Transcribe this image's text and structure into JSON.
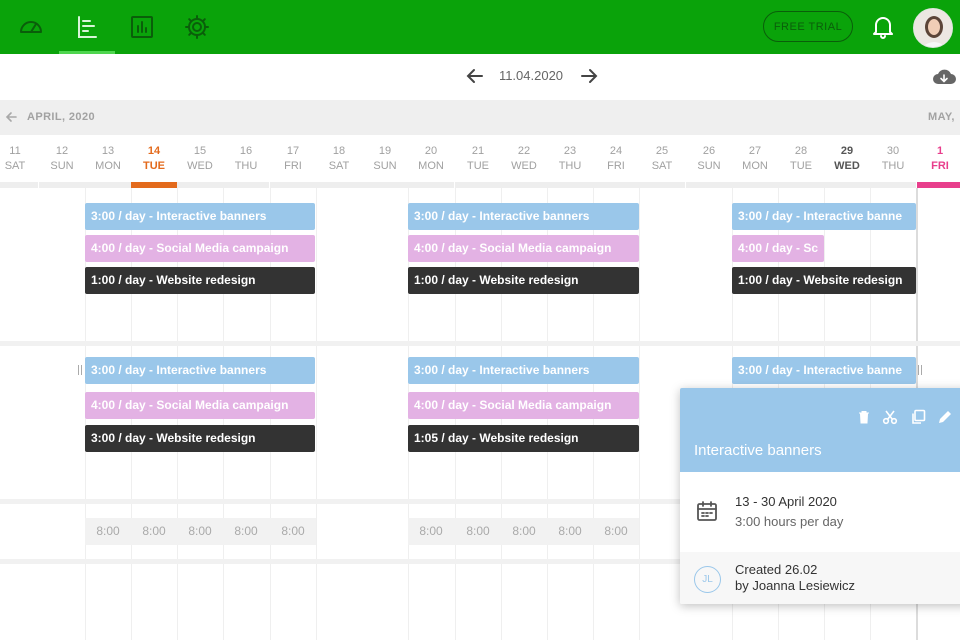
{
  "topbar": {
    "trial_label": "FREE TRIAL",
    "icons": [
      "dashboard-icon",
      "timeline-icon",
      "reports-icon",
      "settings-icon"
    ]
  },
  "date_nav": {
    "current": "11.04.2020"
  },
  "months": {
    "current": "APRIL, 2020",
    "next": "MAY,"
  },
  "days": [
    {
      "num": "11",
      "wd": "SAT"
    },
    {
      "num": "12",
      "wd": "SUN"
    },
    {
      "num": "13",
      "wd": "MON"
    },
    {
      "num": "14",
      "wd": "TUE"
    },
    {
      "num": "15",
      "wd": "WED"
    },
    {
      "num": "16",
      "wd": "THU"
    },
    {
      "num": "17",
      "wd": "FRI"
    },
    {
      "num": "18",
      "wd": "SAT"
    },
    {
      "num": "19",
      "wd": "SUN"
    },
    {
      "num": "20",
      "wd": "MON"
    },
    {
      "num": "21",
      "wd": "TUE"
    },
    {
      "num": "22",
      "wd": "WED"
    },
    {
      "num": "23",
      "wd": "THU"
    },
    {
      "num": "24",
      "wd": "FRI"
    },
    {
      "num": "25",
      "wd": "SAT"
    },
    {
      "num": "26",
      "wd": "SUN"
    },
    {
      "num": "27",
      "wd": "MON"
    },
    {
      "num": "28",
      "wd": "TUE"
    },
    {
      "num": "29",
      "wd": "WED"
    },
    {
      "num": "30",
      "wd": "THU"
    },
    {
      "num": "1",
      "wd": "FRI"
    }
  ],
  "tasks": {
    "r1_w1_blue": "3:00 / day - Interactive banners",
    "r1_w1_pink": "4:00 / day - Social Media campaign",
    "r1_w1_dark": "1:00 / day - Website redesign",
    "r1_w2_blue": "3:00 / day - Interactive banners",
    "r1_w2_pink": "4:00 / day - Social Media campaign",
    "r1_w2_dark": "1:00 / day - Website redesign",
    "r1_w3_blue": "3:00 / day - Interactive banne",
    "r1_w3_pink": "4:00 / day - Sc",
    "r1_w3_dark": "1:00 / day - Website redesign",
    "r2_w1_blue": "3:00 / day - Interactive banners",
    "r2_w1_pink": "4:00 / day - Social Media campaign",
    "r2_w1_dark": "3:00 / day - Website redesign",
    "r2_w2_blue": "3:00 / day - Interactive banners",
    "r2_w2_pink": "4:00 / day - Social Media campaign",
    "r2_w2_dark": "1:05 / day - Website redesign",
    "r2_w3_blue": "3:00 / day - Interactive banne"
  },
  "hours": [
    "8:00",
    "8:00",
    "8:00",
    "8:00",
    "8:00",
    "8:00",
    "8:00",
    "8:00",
    "8:00",
    "8:00"
  ],
  "panel": {
    "title": "Interactive banners",
    "dates": "13 - 30 April 2020",
    "hours_per_day": "3:00 hours per day",
    "initials": "JL",
    "created": "Created 26.02",
    "by": "by Joanna Lesiewicz"
  },
  "colors": {
    "topbar": "#0aa30a",
    "today": "#e36a1c",
    "next_month": "#e83e8c",
    "task_blue": "#9ac7ea",
    "task_pink": "#e3b2e4",
    "task_dark": "#333333"
  }
}
